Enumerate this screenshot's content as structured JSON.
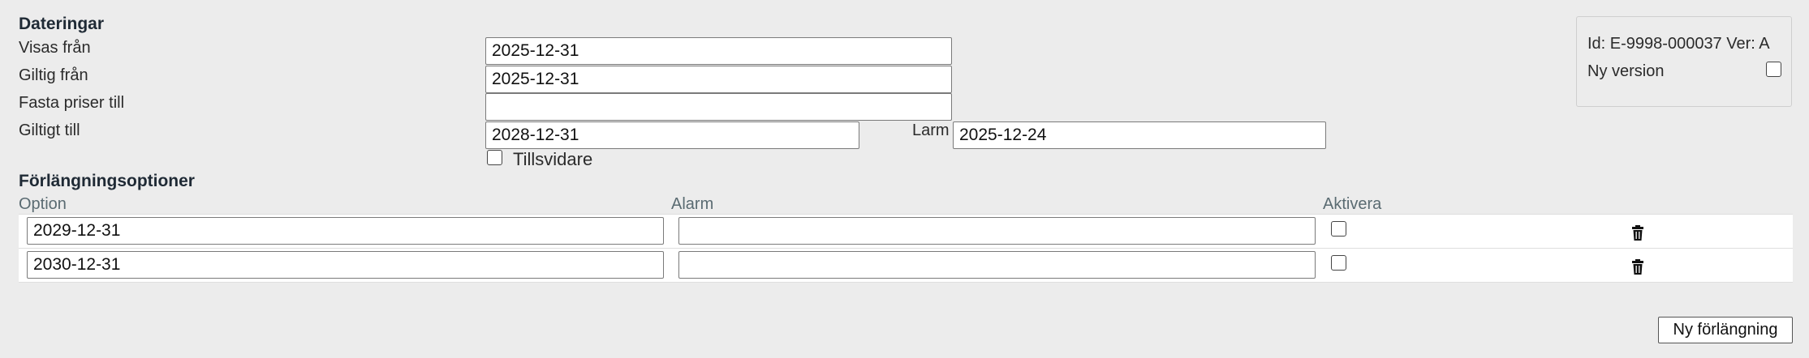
{
  "dates": {
    "heading": "Dateringar",
    "visas_fran": {
      "label": "Visas från",
      "value": "2025-12-31"
    },
    "giltig_fran": {
      "label": "Giltig från",
      "value": "2025-12-31"
    },
    "fasta_priser_till": {
      "label": "Fasta priser till",
      "value": ""
    },
    "giltigt_till": {
      "label": "Giltigt till",
      "value": "2028-12-31"
    },
    "larm": {
      "label": "Larm",
      "value": "2025-12-24"
    },
    "tillsvidare": {
      "label": "Tillsvidare",
      "checked": false
    }
  },
  "extensions": {
    "heading": "Förlängningsoptioner",
    "columns": {
      "option": "Option",
      "alarm": "Alarm",
      "activate": "Aktivera"
    },
    "rows": [
      {
        "option": "2029-12-31",
        "alarm": "",
        "activate": false
      },
      {
        "option": "2030-12-31",
        "alarm": "",
        "activate": false
      }
    ],
    "new_button": "Ny förlängning"
  },
  "info": {
    "id_text": "Id: E-9998-000037 Ver: A",
    "new_version_label": "Ny version",
    "new_version_checked": false
  },
  "icons": {
    "delete": "trash-icon"
  }
}
